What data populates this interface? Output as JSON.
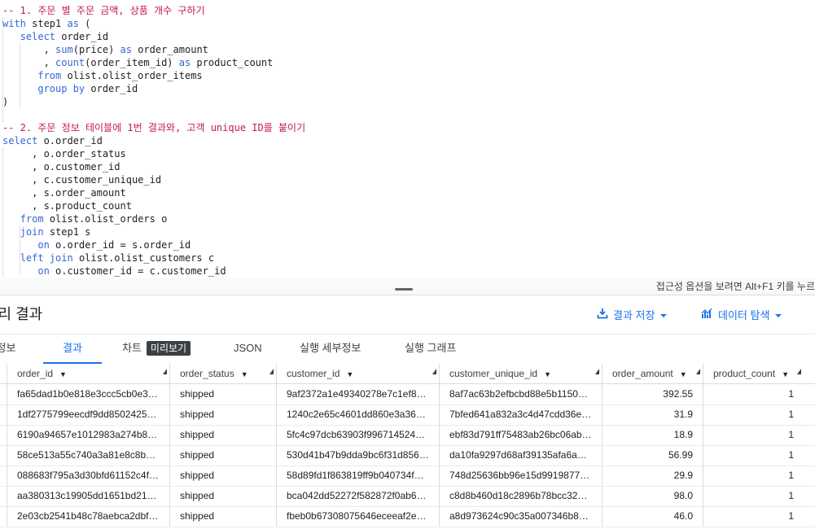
{
  "editor": {
    "lines": [
      [
        {
          "t": "-- 1. 주문 별 주문 금액, 상품 개수 구하기",
          "c": "cm"
        }
      ],
      [
        {
          "t": "with",
          "c": "kw"
        },
        {
          "t": " step1 "
        },
        {
          "t": "as",
          "c": "kw"
        },
        {
          "t": " ("
        }
      ],
      [
        {
          "t": "   "
        },
        {
          "t": "select",
          "c": "kw"
        },
        {
          "t": " order_id"
        }
      ],
      [
        {
          "t": "       , "
        },
        {
          "t": "sum",
          "c": "fn"
        },
        {
          "t": "(price) "
        },
        {
          "t": "as",
          "c": "kw"
        },
        {
          "t": " order_amount"
        }
      ],
      [
        {
          "t": "       , "
        },
        {
          "t": "count",
          "c": "fn"
        },
        {
          "t": "(order_item_id) "
        },
        {
          "t": "as",
          "c": "kw"
        },
        {
          "t": " product_count"
        }
      ],
      [
        {
          "t": "      "
        },
        {
          "t": "from",
          "c": "kw"
        },
        {
          "t": " olist.olist_order_items"
        }
      ],
      [
        {
          "t": "      "
        },
        {
          "t": "group by",
          "c": "kw"
        },
        {
          "t": " order_id"
        }
      ],
      [
        {
          "t": ")"
        }
      ],
      [
        {
          "t": ""
        }
      ],
      [
        {
          "t": "-- 2. 주문 정보 테이블에 1번 결과와, 고객 unique ID를 붙이기",
          "c": "cm"
        }
      ],
      [
        {
          "t": "select",
          "c": "kw"
        },
        {
          "t": " o.order_id"
        }
      ],
      [
        {
          "t": "     , o.order_status"
        }
      ],
      [
        {
          "t": "     , o.customer_id"
        }
      ],
      [
        {
          "t": "     , c.customer_unique_id"
        }
      ],
      [
        {
          "t": "     , s.order_amount"
        }
      ],
      [
        {
          "t": "     , s.product_count"
        }
      ],
      [
        {
          "t": "   "
        },
        {
          "t": "from",
          "c": "kw"
        },
        {
          "t": " olist.olist_orders o"
        }
      ],
      [
        {
          "t": "   "
        },
        {
          "t": "join",
          "c": "kw"
        },
        {
          "t": " step1 s"
        }
      ],
      [
        {
          "t": "      "
        },
        {
          "t": "on",
          "c": "kw"
        },
        {
          "t": " o.order_id = s.order_id"
        }
      ],
      [
        {
          "t": "   "
        },
        {
          "t": "left join",
          "c": "kw"
        },
        {
          "t": " olist.olist_customers c"
        }
      ],
      [
        {
          "t": "      "
        },
        {
          "t": "on",
          "c": "kw"
        },
        {
          "t": " o.customer_id = c.customer_id"
        }
      ]
    ]
  },
  "accessibility_hint": "접근성 옵션을 보려면 Alt+F1 키를 누르",
  "results_title": "쿼리 결과",
  "save_results_label": "결과 저장",
  "explore_data_label": "데이터 탐색",
  "tabs": {
    "info": "작업 정보",
    "results": "결과",
    "chart": "차트",
    "preview_badge": "미리보기",
    "json": "JSON",
    "execution_details": "실행 세부정보",
    "execution_graph": "실행 그래프"
  },
  "table": {
    "columns": [
      "order_id",
      "order_status",
      "customer_id",
      "customer_unique_id",
      "order_amount",
      "product_count"
    ],
    "rows": [
      [
        "fa65dad1b0e818e3ccc5cb0e3…",
        "shipped",
        "9af2372a1e49340278e7c1ef8…",
        "8af7ac63b2efbcbd88e5b1150…",
        "392.55",
        "1"
      ],
      [
        "1df2775799eecdf9dd8502425…",
        "shipped",
        "1240c2e65c4601dd860e3a367…",
        "7bfed641a832a3c4d47cdd36e…",
        "31.9",
        "1"
      ],
      [
        "6190a94657e1012983a274b8…",
        "shipped",
        "5fc4c97dcb63903f996714524…",
        "ebf83d791ff75483ab26bc06ab…",
        "18.9",
        "1"
      ],
      [
        "58ce513a55c740a3a81e8c8b7…",
        "shipped",
        "530d41b47b9dda9bc6f31d856…",
        "da10fa9297d68af39135afa6a3…",
        "56.99",
        "1"
      ],
      [
        "088683f795a3d30bfd61152c4f…",
        "shipped",
        "58d89fd1f863819ff9b040734f…",
        "748d25636bb96e15d9919877f…",
        "29.9",
        "1"
      ],
      [
        "aa380313c19905dd1651bd21…",
        "shipped",
        "bca042dd52272f582872f0ab6…",
        "c8d8b460d18c2896b78bcc324…",
        "98.0",
        "1"
      ],
      [
        "2e03cb2541b48c78aebca2dbf…",
        "shipped",
        "fbeb0b67308075646eceeaf2e…",
        "a8d973624c90c35a007346b8…",
        "46.0",
        "1"
      ]
    ]
  }
}
